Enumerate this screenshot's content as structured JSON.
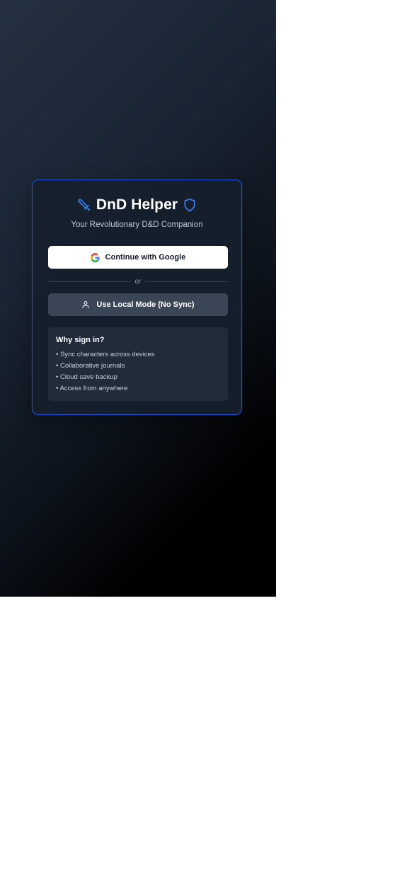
{
  "app": {
    "title": "DnD Helper",
    "subtitle": "Your Revolutionary D&D Companion"
  },
  "auth": {
    "google_button_label": "Continue with Google",
    "divider_text": "or",
    "local_button_label": "Use Local Mode (No Sync)"
  },
  "benefits": {
    "title": "Why sign in?",
    "items": [
      "• Sync characters across devices",
      "• Collaborative journals",
      "• Cloud save backup",
      "• Access from anywhere"
    ]
  },
  "icons": {
    "title_left": "sword-icon",
    "title_right": "shield-icon",
    "google": "google-logo-icon",
    "local": "user-icon"
  },
  "colors": {
    "accent": "#3b82f6",
    "card_border": "#1d4ed8",
    "google_button_bg": "#ffffff",
    "local_button_bg": "#3a4556"
  }
}
